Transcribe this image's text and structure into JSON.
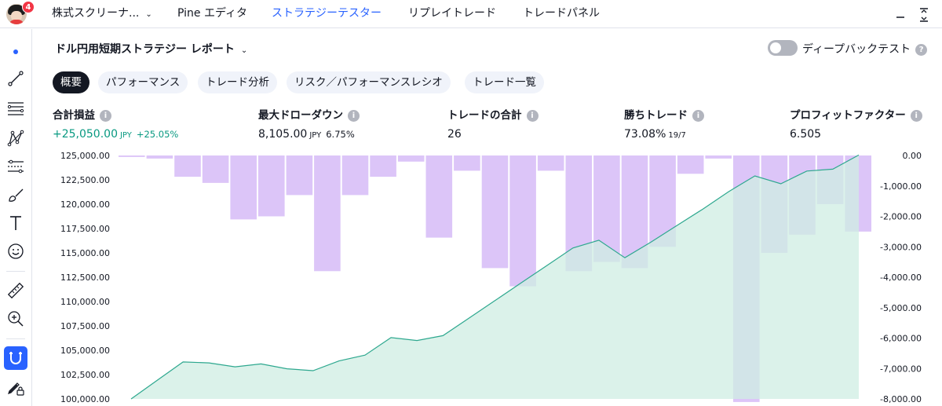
{
  "nav": {
    "badge_count": "4",
    "items": [
      {
        "label": "株式スクリーナ...",
        "has_chevron": true,
        "active": false
      },
      {
        "label": "Pine エディタ",
        "has_chevron": false,
        "active": false
      },
      {
        "label": "ストラテジーテスター",
        "has_chevron": false,
        "active": true
      },
      {
        "label": "リプレイトレード",
        "has_chevron": false,
        "active": false
      },
      {
        "label": "トレードパネル",
        "has_chevron": false,
        "active": false
      }
    ],
    "accent_color": "#2962ff"
  },
  "left_toolbar": {
    "tools": [
      "cursor-dot-icon",
      "trend-line-icon",
      "fib-lines-icon",
      "pattern-icon",
      "measure-lines-icon",
      "brush-icon",
      "text-icon",
      "emoji-icon",
      "ruler-icon",
      "zoom-in-icon",
      "magnet-icon",
      "lock-pencil-icon"
    ]
  },
  "report": {
    "title": "ドル円用短期ストラテジー レポート",
    "deep_backtest_label": "ディープバックテスト",
    "deep_backtest_enabled": false
  },
  "tabs": [
    {
      "label": "概要",
      "active": true
    },
    {
      "label": "パフォーマンス",
      "active": false
    },
    {
      "label": "トレード分析",
      "active": false
    },
    {
      "label": "リスク／パフォーマンスレシオ",
      "active": false
    },
    {
      "label": "トレード一覧",
      "active": false
    }
  ],
  "metrics": {
    "net_profit": {
      "label": "合計損益",
      "value": "+25,050.00",
      "unit": "JPY",
      "pct": "+25.05%"
    },
    "max_drawdown": {
      "label": "最大ドローダウン",
      "value": "8,105.00",
      "unit": "JPY",
      "pct": "6.75%"
    },
    "total_trades": {
      "label": "トレードの合計",
      "value": "26"
    },
    "win_trades": {
      "label": "勝ちトレード",
      "value": "73.08%",
      "sub": "19/7"
    },
    "profit_factor": {
      "label": "プロフィットファクター",
      "value": "6.505"
    }
  },
  "chart_data": {
    "type": "area",
    "left_axis": {
      "ticks": [
        "125,000.00",
        "122,500.00",
        "120,000.00",
        "117,500.00",
        "115,000.00",
        "112,500.00",
        "110,000.00",
        "107,500.00",
        "105,000.00",
        "102,500.00",
        "100,000.00"
      ],
      "ylim": [
        100000,
        125000
      ]
    },
    "right_axis": {
      "ticks": [
        "0.00",
        "-1,000.00",
        "-2,000.00",
        "-3,000.00",
        "-4,000.00",
        "-5,000.00",
        "-6,000.00",
        "-7,000.00",
        "-8,000.00"
      ],
      "ylim": [
        -8000,
        0
      ]
    },
    "equity": {
      "values": [
        100000,
        101900,
        103800,
        103700,
        103300,
        103600,
        103100,
        102900,
        103900,
        104500,
        106300,
        106000,
        106500,
        108300,
        110100,
        111900,
        113700,
        115500,
        116300,
        114500,
        116100,
        117800,
        119500,
        121300,
        122900,
        122100,
        123400,
        123600,
        125050
      ],
      "line_color": "#2ea88f",
      "fill_color": "#cfeee3"
    },
    "drawdown": {
      "values": [
        -50,
        -100,
        -700,
        -900,
        -2100,
        -2000,
        -1300,
        -3800,
        -1300,
        -700,
        -200,
        -2700,
        -500,
        -3700,
        -4300,
        -500,
        -3800,
        -3500,
        -3700,
        -3000,
        -600,
        -100,
        -8100,
        -3200,
        -2600,
        -1600,
        -2500
      ],
      "bar_color": "#dcc5f8"
    }
  }
}
